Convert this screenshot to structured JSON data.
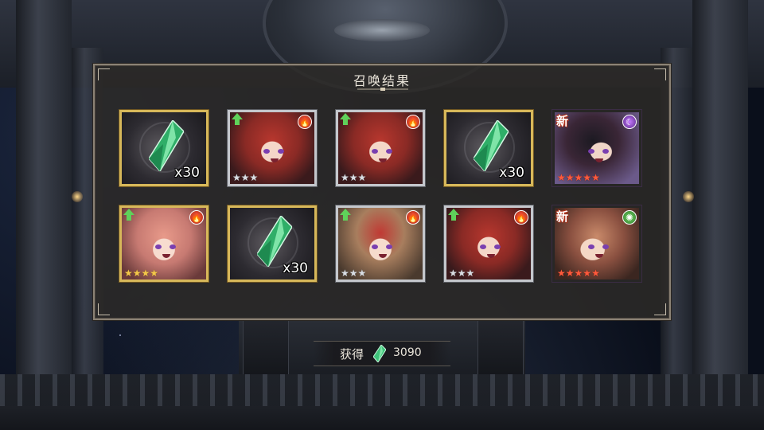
{
  "dialog": {
    "title": "召唤结果"
  },
  "results": [
    {
      "kind": "crystal",
      "frame": "gold",
      "quantity": "x30"
    },
    {
      "kind": "character",
      "frame": "silver",
      "portrait": "red-hair-elf",
      "upgrade": true,
      "element": "fire",
      "element_icon": "fire-icon",
      "is_new": false,
      "star_color": "silver",
      "stars": 3
    },
    {
      "kind": "character",
      "frame": "silver",
      "portrait": "red-hair-elf",
      "upgrade": true,
      "element": "fire",
      "element_icon": "fire-icon",
      "is_new": false,
      "star_color": "silver",
      "stars": 3
    },
    {
      "kind": "crystal",
      "frame": "gold",
      "quantity": "x30"
    },
    {
      "kind": "character",
      "frame": "rainbow",
      "portrait": "dark-hair-girl",
      "upgrade": false,
      "element": "dark",
      "element_icon": "moon-icon",
      "is_new": true,
      "new_label": "新",
      "star_color": "red",
      "stars": 5
    },
    {
      "kind": "character",
      "frame": "gold",
      "portrait": "pink-hair-girl",
      "upgrade": true,
      "element": "fire",
      "element_icon": "fire-icon",
      "is_new": false,
      "star_color": "gold",
      "stars": 4
    },
    {
      "kind": "crystal",
      "frame": "gold",
      "quantity": "x30"
    },
    {
      "kind": "character",
      "frame": "silver",
      "portrait": "red-hood-girl",
      "upgrade": true,
      "element": "fire",
      "element_icon": "fire-icon",
      "is_new": false,
      "star_color": "silver",
      "stars": 3
    },
    {
      "kind": "character",
      "frame": "silver",
      "portrait": "red-hair-elf",
      "upgrade": true,
      "element": "fire",
      "element_icon": "fire-icon",
      "is_new": false,
      "star_color": "silver",
      "stars": 3
    },
    {
      "kind": "character",
      "frame": "rainbow",
      "portrait": "flower-crown-girl",
      "upgrade": false,
      "element": "wind",
      "element_icon": "wind-swirl-icon",
      "is_new": true,
      "new_label": "新",
      "star_color": "red",
      "stars": 5
    }
  ],
  "obtained": {
    "label": "获得",
    "icon": "green-crystal-icon",
    "value": "3090"
  }
}
